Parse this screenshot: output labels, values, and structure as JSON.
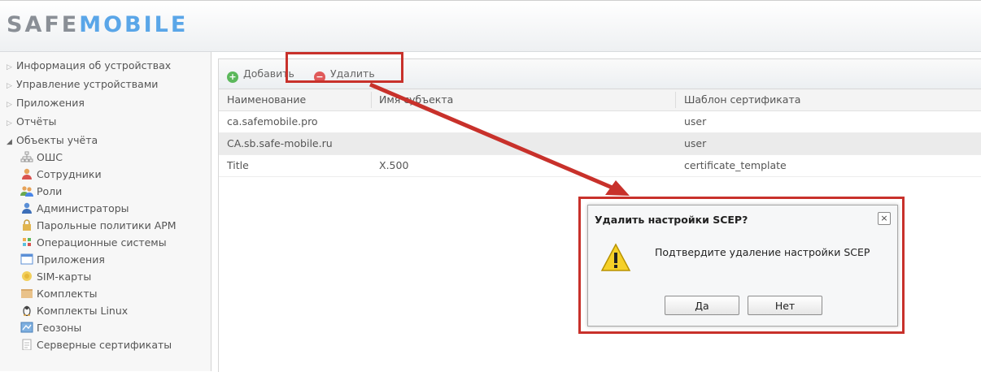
{
  "app": {
    "logo_part1": "SAFE",
    "logo_part2": "MOBILE"
  },
  "sidebar": {
    "items": [
      {
        "label": "Информация об устройствах",
        "icon": "collapsed-triangle-icon"
      },
      {
        "label": "Управление устройствами",
        "icon": "collapsed-triangle-icon"
      },
      {
        "label": "Приложения",
        "icon": "collapsed-triangle-icon"
      },
      {
        "label": "Отчёты",
        "icon": "collapsed-triangle-icon"
      },
      {
        "label": "Объекты учёта",
        "icon": "expanded-triangle-icon"
      }
    ],
    "subitems": [
      {
        "label": "ОШС",
        "icon": "org-structure-icon"
      },
      {
        "label": "Сотрудники",
        "icon": "employee-icon"
      },
      {
        "label": "Роли",
        "icon": "roles-icon"
      },
      {
        "label": "Администраторы",
        "icon": "admin-icon"
      },
      {
        "label": "Парольные политики АРМ",
        "icon": "lock-icon"
      },
      {
        "label": "Операционные системы",
        "icon": "os-icon"
      },
      {
        "label": "Приложения",
        "icon": "window-icon"
      },
      {
        "label": "SIM-карты",
        "icon": "sim-icon"
      },
      {
        "label": "Комплекты",
        "icon": "folder-icon"
      },
      {
        "label": "Комплекты Linux",
        "icon": "linux-icon"
      },
      {
        "label": "Геозоны",
        "icon": "map-icon"
      },
      {
        "label": "Серверные сертификаты",
        "icon": "document-icon"
      }
    ]
  },
  "toolbar": {
    "add_label": "Добавить",
    "delete_label": "Удалить"
  },
  "table": {
    "columns": [
      "Наименование",
      "Имя субъекта",
      "Шаблон сертификата"
    ],
    "rows": [
      [
        "ca.safemobile.pro",
        "",
        "user"
      ],
      [
        "CA.sb.safe-mobile.ru",
        "",
        "user"
      ],
      [
        "Title",
        "X.500",
        "certificate_template"
      ]
    ]
  },
  "dialog": {
    "title": "Удалить настройки SCEP?",
    "close_glyph": "×",
    "message": "Подтвердите удаление настройки SCEP",
    "yes_label": "Да",
    "no_label": "Нет"
  },
  "colors": {
    "accent": "#5aa6e8",
    "highlight": "#c8312b",
    "add": "#5cb85c",
    "delete": "#e05a5a"
  }
}
